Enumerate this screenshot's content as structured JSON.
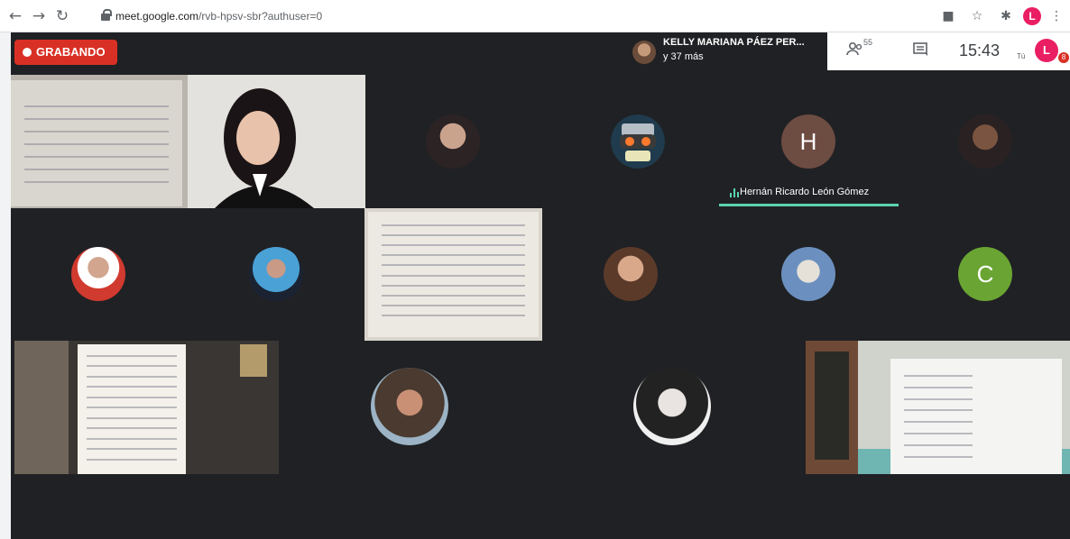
{
  "browser": {
    "back_icon": "arrow-left-icon",
    "forward_icon": "arrow-right-icon",
    "reload_icon": "reload-icon",
    "url_host": "meet.google.com",
    "url_path": "/rvb-hpsv-sbr?authuser=0",
    "profile_initial": "L"
  },
  "meet": {
    "recording_label": "GRABANDO",
    "presenter_name": "KELLY MARIANA PÁEZ PER...",
    "presenter_more": "y 37 más",
    "participants_count": "55",
    "time": "15:43",
    "self_label": "Tú",
    "self_initial": "L",
    "notification_count": "8",
    "speaker_name": "Hernán Ricardo León Gómez",
    "tile_initials": [
      "H",
      "C"
    ]
  },
  "colors": {
    "recording": "#d93025",
    "background": "#202124",
    "speaking": "#5bd3b0",
    "initial_h": "#6d4c41",
    "initial_c": "#6aa533"
  }
}
